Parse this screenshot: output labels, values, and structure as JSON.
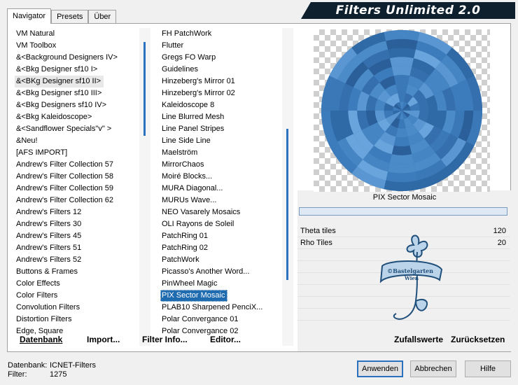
{
  "banner_title": "Filters Unlimited 2.0",
  "tabs": [
    "Navigator",
    "Presets",
    "Über"
  ],
  "categories": [
    "VM Natural",
    "VM Toolbox",
    "&<Background Designers IV>",
    "&<Bkg Designer sf10 I>",
    "&<BKg Designer sf10 II>",
    "&<Bkg Designer sf10 III>",
    "&<Bkg Designers sf10 IV>",
    "&<Bkg Kaleidoscope>",
    "&<Sandflower Specials\"v\" >",
    "&Neu!",
    "[AFS IMPORT]",
    "Andrew's Filter Collection 57",
    "Andrew's Filter Collection 58",
    "Andrew's Filter Collection 59",
    "Andrew's Filter Collection 62",
    "Andrew's Filters 12",
    "Andrew's Filters 30",
    "Andrew's Filters 45",
    "Andrew's Filters 51",
    "Andrew's Filters 52",
    "Buttons & Frames",
    "Color Effects",
    "Color Filters",
    "Convolution Filters",
    "Distortion Filters",
    "Edge, Square"
  ],
  "selected_category_index": 4,
  "filters": [
    "FH PatchWork",
    "Flutter",
    "Gregs FO Warp",
    "Guidelines",
    "Hinzeberg's Mirror 01",
    "Hinzeberg's Mirror 02",
    "Kaleidoscope 8",
    "Line Blurred Mesh",
    "Line Panel Stripes",
    "Line Side Line",
    "Maelström",
    "MirrorChaos",
    "Moiré Blocks...",
    "MURA Diagonal...",
    "MURUs Wave...",
    "NEO Vasarely Mosaics",
    "OLI Rayons de Soleil",
    "PatchRing 01",
    "PatchRing 02",
    "PatchWork",
    "Picasso's Another Word...",
    "PinWheel Magic",
    "PIX Sector Mosaic",
    "PLAB10 Sharpened PenciX...",
    "Polar Convergance 01",
    "Polar Convergance 02"
  ],
  "marked_filter_indices": [
    1,
    3
  ],
  "highlighted_filter_index": 22,
  "preview": {
    "filter_name": "PIX Sector Mosaic"
  },
  "params": [
    {
      "label": "Theta tiles",
      "value": "120"
    },
    {
      "label": "Rho Tiles",
      "value": "20"
    },
    {
      "label": "",
      "value": ""
    },
    {
      "label": "",
      "value": ""
    },
    {
      "label": "",
      "value": ""
    },
    {
      "label": "",
      "value": ""
    },
    {
      "label": "",
      "value": ""
    },
    {
      "label": "",
      "value": ""
    }
  ],
  "logo_text": {
    "line1": "©Bastelgarten",
    "line2": "Wien"
  },
  "bottom_buttons": {
    "datenbank": "Datenbank",
    "import": "Import...",
    "filter_info": "Filter Info...",
    "editor": "Editor...",
    "zufallswerte": "Zufallswerte",
    "zuruecksetzen": "Zurücksetzen"
  },
  "status": {
    "datenbank_label": "Datenbank:",
    "datenbank_value": "ICNET-Filters",
    "filter_label": "Filter:",
    "filter_value": "1275"
  },
  "dialog_buttons": {
    "anwenden": "Anwenden",
    "abbrechen": "Abbrechen",
    "hilfe": "Hilfe"
  },
  "colors": {
    "accent": "#2a72c0",
    "highlight": "#1e6bb0",
    "banner_bg": "#0e1f2d",
    "mosaic_base": "#3a78b8"
  }
}
